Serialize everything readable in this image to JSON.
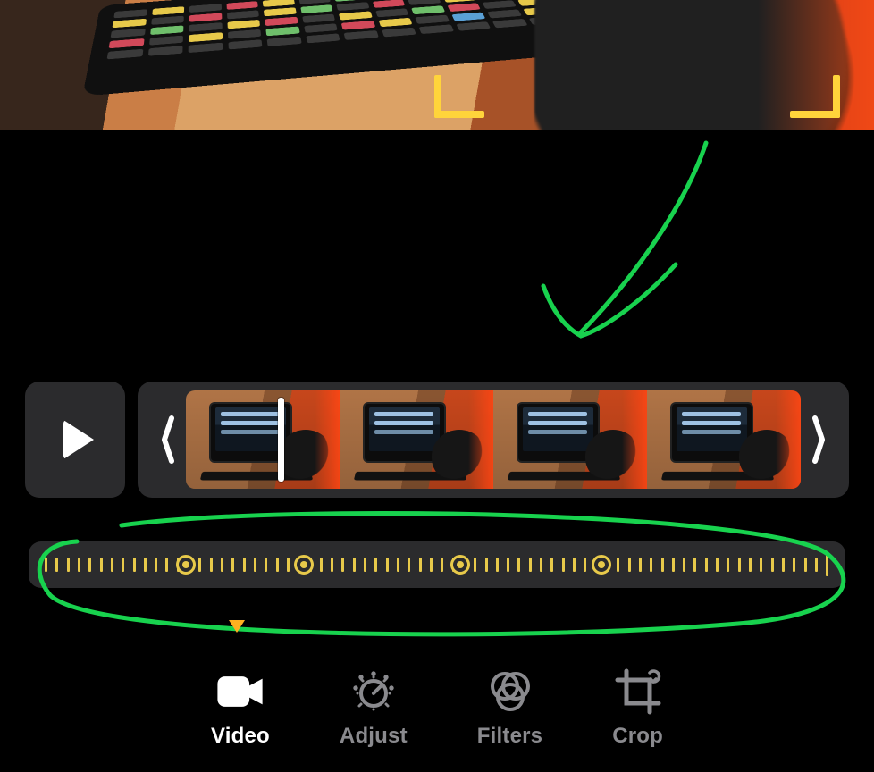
{
  "colors": {
    "accent_yellow": "#e7c94a",
    "annotation_green": "#18d24e"
  },
  "preview": {
    "crop_visible": true
  },
  "timeline": {
    "play_state": "paused",
    "frame_count": 4,
    "playhead_frame_index": 0,
    "playhead_fraction_within_frame": 0.6
  },
  "speed_rail": {
    "tick_count": 72,
    "keyframes_percent": [
      18,
      33,
      53,
      71
    ]
  },
  "tabs": {
    "items": [
      {
        "id": "video",
        "label": "Video",
        "active": true
      },
      {
        "id": "adjust",
        "label": "Adjust",
        "active": false
      },
      {
        "id": "filters",
        "label": "Filters",
        "active": false
      },
      {
        "id": "crop",
        "label": "Crop",
        "active": false
      }
    ],
    "indicator_tab": "video"
  },
  "annotation": {
    "arrow": true,
    "circle_rail": true
  }
}
